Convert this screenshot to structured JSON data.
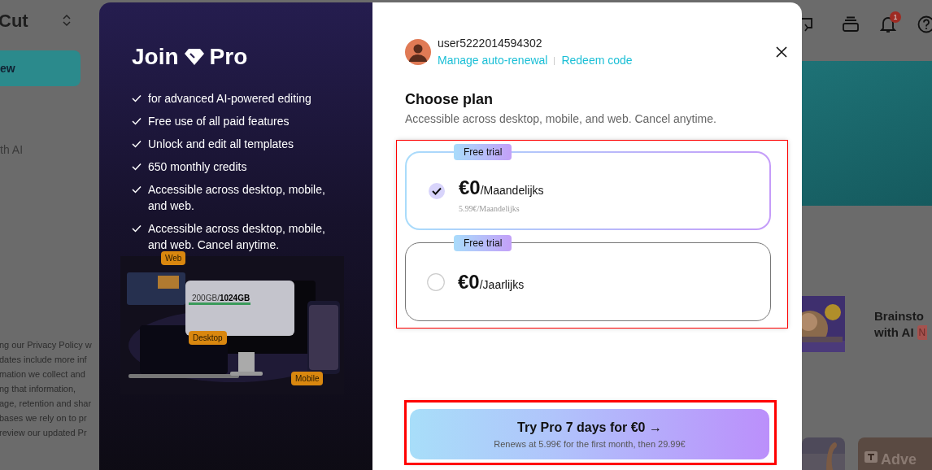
{
  "background": {
    "logo": "Cut",
    "sidebar_button": "ew",
    "sidebar_item": "th AI",
    "privacy_lines": [
      "ng our Privacy Policy w",
      "dates include more inf",
      "mation we collect and",
      "ng that information,",
      "age, retention and shar",
      "bases we rely on to pr",
      "review our updated Pr"
    ],
    "notification_count": "1",
    "promo_title_lines": [
      "Brainsto",
      "with AI"
    ],
    "promo_badge": "N",
    "card_label": "Adve"
  },
  "dialog": {
    "title_left": "Join",
    "title_right": "Pro",
    "features": [
      "for advanced AI-powered editing",
      "Free use of all paid features",
      "Unlock and edit all templates",
      "650 monthly credits",
      "Accessible across desktop, mobile, and web.",
      "Accessible across desktop, mobile, and web. Cancel anytime."
    ],
    "illustration_labels": {
      "web": "Web",
      "storage": "200GB/**1024GB**",
      "desktop": "Desktop",
      "mobile": "Mobile"
    },
    "user": {
      "name": "user5222014594302"
    },
    "links": [
      "Manage auto-renewal",
      "Redeem code"
    ],
    "heading": "Choose plan",
    "subtitle": "Accessible across desktop, mobile, and web. Cancel anytime.",
    "plans_highlighted": true,
    "plans": [
      {
        "badge": "Free trial",
        "price": "€0",
        "period": "/Maandelijks",
        "note": "5.99€/Maandelijks",
        "selected": true
      },
      {
        "badge": "Free trial",
        "price": "€0",
        "period": "/Jaarlijks",
        "selected": false
      }
    ],
    "cta": {
      "title": "Try Pro 7 days for €0",
      "arrow": "→",
      "note": "Renews at 5.99€ for the first month, then 29.99€",
      "highlighted": true
    }
  }
}
